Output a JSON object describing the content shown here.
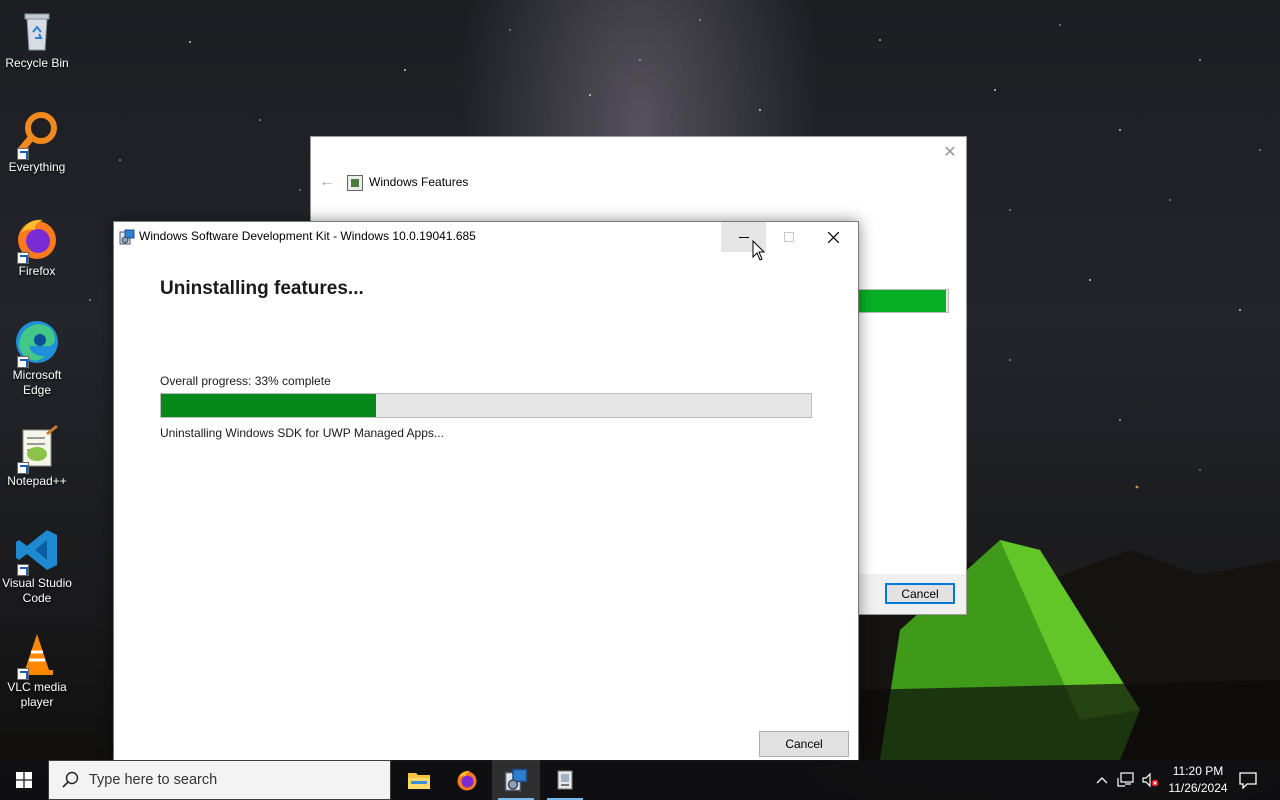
{
  "desktop": {
    "icons": [
      {
        "label": "Recycle Bin",
        "icon": "recycle-bin-icon"
      },
      {
        "label": "Everything",
        "icon": "everything-search-icon"
      },
      {
        "label": "Firefox",
        "icon": "firefox-icon"
      },
      {
        "label": "Microsoft Edge",
        "icon": "edge-icon"
      },
      {
        "label": "Notepad++",
        "icon": "notepadpp-icon"
      },
      {
        "label": "Visual Studio Code",
        "icon": "vscode-icon"
      },
      {
        "label": "VLC media player",
        "icon": "vlc-icon"
      }
    ]
  },
  "features_window": {
    "title": "Windows Features",
    "back_icon": "back-arrow-icon",
    "close_icon": "close-icon",
    "progress": 0.98,
    "cancel_label": "Cancel",
    "progress_color": "#06b025"
  },
  "sdk_window": {
    "title": "Windows Software Development Kit - Windows 10.0.19041.685",
    "heading": "Uninstalling features...",
    "progress_label": "Overall progress: 33% complete",
    "progress": 0.33,
    "status": "Uninstalling Windows SDK for UWP Managed Apps...",
    "cancel_label": "Cancel",
    "progress_color": "#06891a"
  },
  "taskbar": {
    "search_placeholder": "Type here to search",
    "apps": [
      {
        "name": "file-explorer",
        "active": false
      },
      {
        "name": "firefox",
        "active": false
      },
      {
        "name": "sdk-installer",
        "active": true
      },
      {
        "name": "windows-features",
        "active": false
      }
    ],
    "time": "11:20 PM",
    "date": "11/26/2024"
  }
}
